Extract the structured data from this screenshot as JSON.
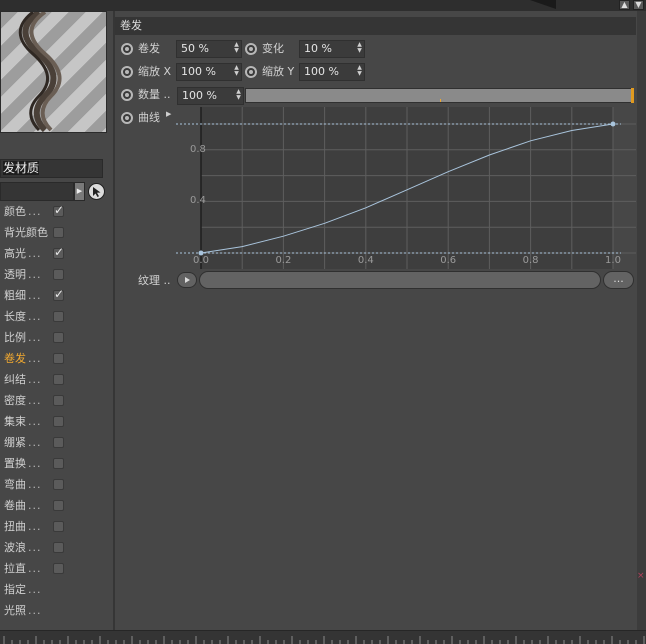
{
  "left": {
    "material_name": "发材质",
    "channels": [
      {
        "label": "颜色",
        "dots": "...",
        "checked": true
      },
      {
        "label": "背光颜色",
        "dots": "",
        "checked": false
      },
      {
        "label": "高光",
        "dots": "...",
        "checked": true
      },
      {
        "label": "透明",
        "dots": "...",
        "checked": false
      },
      {
        "label": "粗细",
        "dots": "...",
        "checked": true
      },
      {
        "label": "长度",
        "dots": "...",
        "checked": false
      },
      {
        "label": "比例",
        "dots": "...",
        "checked": false
      },
      {
        "label": "卷发",
        "dots": "...",
        "checked": false,
        "active": true
      },
      {
        "label": "纠结",
        "dots": "...",
        "checked": false
      },
      {
        "label": "密度",
        "dots": "...",
        "checked": false
      },
      {
        "label": "集束",
        "dots": "...",
        "checked": false
      },
      {
        "label": "绷紧",
        "dots": "...",
        "checked": false
      },
      {
        "label": "置换",
        "dots": "...",
        "checked": false
      },
      {
        "label": "弯曲",
        "dots": "...",
        "checked": false
      },
      {
        "label": "卷曲",
        "dots": "...",
        "checked": false
      },
      {
        "label": "扭曲",
        "dots": "...",
        "checked": false
      },
      {
        "label": "波浪",
        "dots": "...",
        "checked": false
      },
      {
        "label": "拉直",
        "dots": "...",
        "checked": false
      },
      {
        "label": "指定",
        "dots": "...",
        "checked": null
      },
      {
        "label": "光照",
        "dots": "...",
        "checked": null
      }
    ]
  },
  "section": {
    "title": "卷发"
  },
  "params": {
    "curl": {
      "label": "卷发",
      "value": "50 %"
    },
    "variation": {
      "label": "变化",
      "value": "10 %"
    },
    "scale_x": {
      "label": "缩放 X",
      "value": "100 %"
    },
    "scale_y": {
      "label": "缩放 Y",
      "value": "100 %"
    },
    "amount": {
      "label": "数量 ..",
      "value": "100 %",
      "slider_fraction": 1.0
    },
    "curve": {
      "label": "曲线"
    },
    "texture": {
      "label": "纹理 ..",
      "more_label": "..."
    }
  },
  "chart_data": {
    "type": "line",
    "xlim": [
      0.0,
      1.0
    ],
    "ylim": [
      0.0,
      1.0
    ],
    "x_ticks": [
      "0.0",
      "0.2",
      "0.4",
      "0.6",
      "0.8",
      "1.0"
    ],
    "y_ticks": [
      "0.4",
      "0.8"
    ],
    "grid": true,
    "series": [
      {
        "x": [
          0.0,
          0.1,
          0.2,
          0.3,
          0.4,
          0.5,
          0.6,
          0.7,
          0.8,
          0.9,
          1.0
        ],
        "y": [
          0.0,
          0.05,
          0.13,
          0.23,
          0.35,
          0.49,
          0.63,
          0.76,
          0.87,
          0.95,
          1.0
        ]
      }
    ],
    "colors": {
      "line": "#a9c4dc",
      "grid": "#5e5e5e",
      "plot_bg": "#3e3e3e"
    }
  }
}
